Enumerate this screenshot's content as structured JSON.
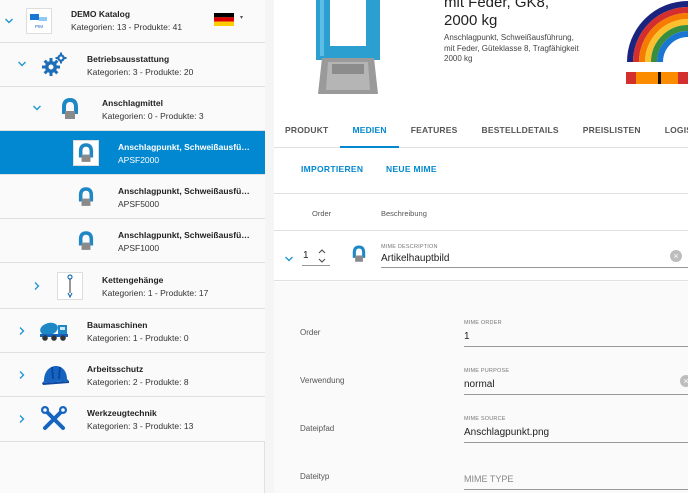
{
  "tree": {
    "root": {
      "title": "DEMO Katalog",
      "sub": "Kategorien: 13 - Produkte: 41",
      "logo_text": "PIM",
      "lang": "DE"
    },
    "items": [
      {
        "title": "Betriebsausstattung",
        "sub": "Kategorien: 3 - Produkte: 20",
        "icon": "gears-icon"
      },
      {
        "title": "Anschlagmittel",
        "sub": "Kategorien: 0 - Produkte: 3",
        "icon": "lifting-point-icon"
      },
      {
        "title": "Anschlagpunkt, Schweißausführung",
        "sub": "APSF2000",
        "icon": "lifting-point-icon"
      },
      {
        "title": "Anschlagpunkt, Schweißausführung",
        "sub": "APSF5000",
        "icon": "lifting-point-icon"
      },
      {
        "title": "Anschlagpunkt, Schweißausführung",
        "sub": "APSF1000",
        "icon": "lifting-point-icon"
      },
      {
        "title": "Kettengehänge",
        "sub": "Kategorien: 1 - Produkte: 17",
        "icon": "chain-icon"
      },
      {
        "title": "Baumaschinen",
        "sub": "Kategorien: 1 - Produkte: 0",
        "icon": "mixer-truck-icon"
      },
      {
        "title": "Arbeitsschutz",
        "sub": "Kategorien: 2 - Produkte: 8",
        "icon": "helmet-icon"
      },
      {
        "title": "Werkzeugtechnik",
        "sub": "Kategorien: 3 - Produkte: 13",
        "icon": "tools-icon"
      }
    ]
  },
  "product": {
    "title_line1": "mit Feder, GK8,",
    "title_line2": "2000 kg",
    "description": "Anschlagpunkt, Schweißausführung, mit Feder, Güteklasse 8, Tragfähigkeit 2000 kg"
  },
  "tabs": [
    "PRODUKT",
    "MEDIEN",
    "FEATURES",
    "BESTELLDETAILS",
    "PREISLISTEN",
    "LOGISTIK"
  ],
  "active_tab": "MEDIEN",
  "actions": {
    "import": "IMPORTIEREN",
    "new_mime": "NEUE MIME"
  },
  "table": {
    "col_order": "Order",
    "col_desc": "Beschreibung",
    "row": {
      "order": "1",
      "desc_label": "MIME DESCRIPTION",
      "desc_value": "Artikelhauptbild"
    }
  },
  "detail": {
    "order_label": "Order",
    "order_field_label": "MIME ORDER",
    "order_value": "1",
    "purpose_label": "Verwendung",
    "purpose_field_label": "MIME PURPOSE",
    "purpose_value": "normal",
    "path_label": "Dateipfad",
    "path_field_label": "MIME SOURCE",
    "path_value": "Anschlagpunkt.png",
    "type_label": "Dateityp",
    "type_placeholder": "MIME TYPE"
  },
  "colors": {
    "accent": "#0288d1",
    "product_blue": "#2b9fd0"
  }
}
